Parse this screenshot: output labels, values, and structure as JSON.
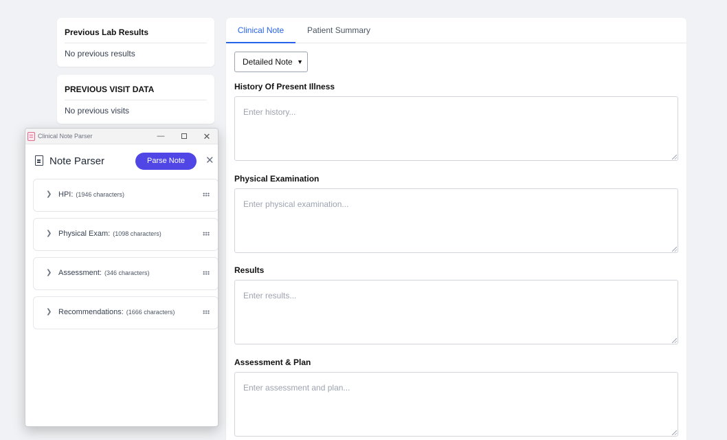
{
  "sidebar": {
    "lab": {
      "title": "Previous Lab Results",
      "body": "No previous results"
    },
    "visit": {
      "title": "PREVIOUS VISIT DATA",
      "body": "No previous visits"
    }
  },
  "main": {
    "tabs": [
      {
        "label": "Clinical Note"
      },
      {
        "label": "Patient Summary"
      }
    ],
    "note_type": {
      "selected": "Detailed Note"
    },
    "fields": [
      {
        "label": "History Of Present Illness",
        "placeholder": "Enter history..."
      },
      {
        "label": "Physical Examination",
        "placeholder": "Enter physical examination..."
      },
      {
        "label": "Results",
        "placeholder": "Enter results..."
      },
      {
        "label": "Assessment & Plan",
        "placeholder": "Enter assessment and plan..."
      }
    ]
  },
  "parser_window": {
    "window_title": "Clinical Note Parser",
    "title": "Note Parser",
    "parse_label": "Parse Note",
    "sections": [
      {
        "name": "HPI:",
        "count": "(1946 characters)"
      },
      {
        "name": "Physical Exam:",
        "count": "(1098 characters)"
      },
      {
        "name": "Assessment:",
        "count": "(346 characters)"
      },
      {
        "name": "Recommendations:",
        "count": "(1666 characters)"
      }
    ]
  },
  "colors": {
    "accent": "#2563eb",
    "parse_button": "#4f46e5"
  }
}
